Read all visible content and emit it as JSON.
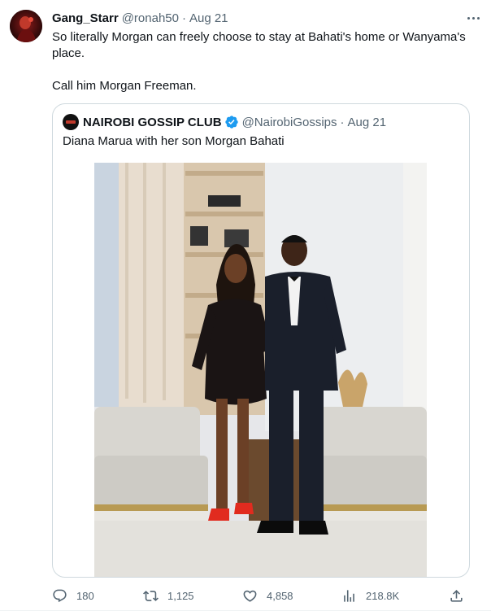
{
  "tweet": {
    "author": {
      "display_name": "Gang_Starr",
      "handle": "@ronah50",
      "date": "Aug 21"
    },
    "separator": "·",
    "text_lines": [
      "So literally Morgan can freely choose to stay at Bahati's home or Wanyama's place.",
      "Call him Morgan Freeman."
    ],
    "icons": {
      "more": "more-options-icon"
    }
  },
  "quoted_tweet": {
    "author": {
      "display_name": "NAIROBI GOSSIP CLUB",
      "handle": "@NairobiGossips",
      "date": "Aug 21",
      "verified": true
    },
    "text": "Diana Marua with her son Morgan Bahati",
    "image_subject": "woman-in-black-dress-and-boy-in-tuxedo"
  },
  "actions": {
    "replies": "180",
    "retweets": "1,125",
    "likes": "4,858",
    "views": "218.8K"
  },
  "colors": {
    "text": "#0f1419",
    "muted": "#536471",
    "border": "#cfd9de",
    "verified": "#1d9bf0"
  }
}
